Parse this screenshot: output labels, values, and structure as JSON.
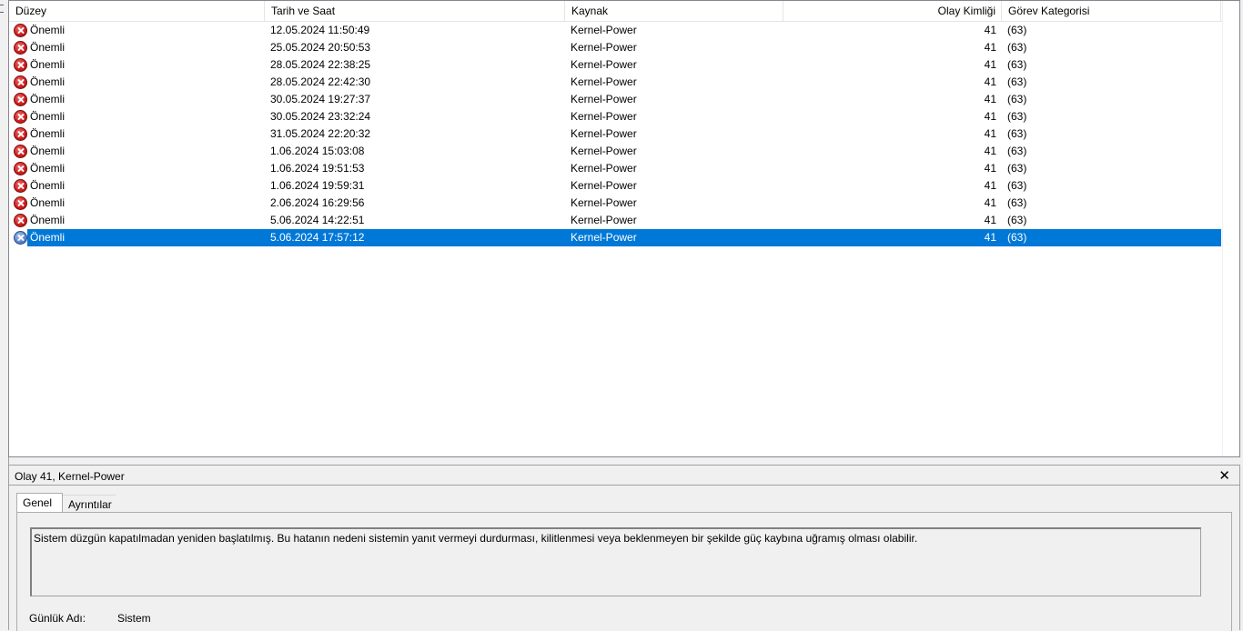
{
  "columns": [
    {
      "label": "Düzey"
    },
    {
      "label": "Tarih ve Saat"
    },
    {
      "label": "Kaynak"
    },
    {
      "label": "Olay Kimliği"
    },
    {
      "label": "Görev Kategorisi"
    }
  ],
  "sort_indicator": "^",
  "events": [
    {
      "level": "Önemli",
      "datetime": "12.05.2024 11:50:49",
      "source": "Kernel-Power",
      "event_id": "41",
      "category": "(63)"
    },
    {
      "level": "Önemli",
      "datetime": "25.05.2024 20:50:53",
      "source": "Kernel-Power",
      "event_id": "41",
      "category": "(63)"
    },
    {
      "level": "Önemli",
      "datetime": "28.05.2024 22:38:25",
      "source": "Kernel-Power",
      "event_id": "41",
      "category": "(63)"
    },
    {
      "level": "Önemli",
      "datetime": "28.05.2024 22:42:30",
      "source": "Kernel-Power",
      "event_id": "41",
      "category": "(63)"
    },
    {
      "level": "Önemli",
      "datetime": "30.05.2024 19:27:37",
      "source": "Kernel-Power",
      "event_id": "41",
      "category": "(63)"
    },
    {
      "level": "Önemli",
      "datetime": "30.05.2024 23:32:24",
      "source": "Kernel-Power",
      "event_id": "41",
      "category": "(63)"
    },
    {
      "level": "Önemli",
      "datetime": "31.05.2024 22:20:32",
      "source": "Kernel-Power",
      "event_id": "41",
      "category": "(63)"
    },
    {
      "level": "Önemli",
      "datetime": "1.06.2024 15:03:08",
      "source": "Kernel-Power",
      "event_id": "41",
      "category": "(63)"
    },
    {
      "level": "Önemli",
      "datetime": "1.06.2024 19:51:53",
      "source": "Kernel-Power",
      "event_id": "41",
      "category": "(63)"
    },
    {
      "level": "Önemli",
      "datetime": "1.06.2024 19:59:31",
      "source": "Kernel-Power",
      "event_id": "41",
      "category": "(63)"
    },
    {
      "level": "Önemli",
      "datetime": "2.06.2024 16:29:56",
      "source": "Kernel-Power",
      "event_id": "41",
      "category": "(63)"
    },
    {
      "level": "Önemli",
      "datetime": "5.06.2024 14:22:51",
      "source": "Kernel-Power",
      "event_id": "41",
      "category": "(63)"
    },
    {
      "level": "Önemli",
      "datetime": "5.06.2024 17:57:12",
      "source": "Kernel-Power",
      "event_id": "41",
      "category": "(63)",
      "selected": true
    }
  ],
  "detail": {
    "title": "Olay 41, Kernel-Power",
    "close_glyph": "✕",
    "tabs": [
      {
        "label": "Genel",
        "active": true
      },
      {
        "label": "Ayrıntılar",
        "active": false
      }
    ],
    "description": "Sistem düzgün kapatılmadan yeniden başlatılmış. Bu hatanın nedeni sistemin yanıt vermeyi durdurması, kilitlenmesi veya beklenmeyen bir şekilde güç kaybına uğramış olması olabilir.",
    "fields": [
      {
        "label": "Günlük Adı:",
        "value": "Sistem"
      }
    ]
  },
  "colors": {
    "selection": "#0078d7",
    "error_icon": "#d02020"
  },
  "icons": {
    "level_error": "error-x-icon",
    "close": "close-icon"
  }
}
